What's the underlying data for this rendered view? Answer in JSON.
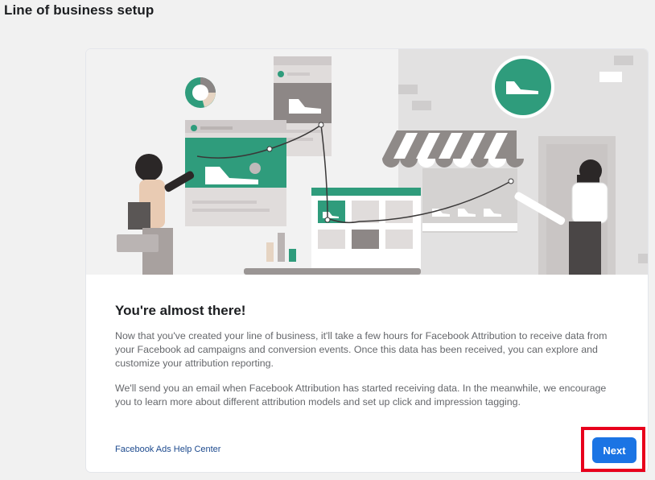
{
  "page": {
    "title": "Line of business setup"
  },
  "card": {
    "heading": "You're almost there!",
    "paragraph1": "Now that you've created your line of business, it'll take a few hours for Facebook Attribution to receive data from your Facebook ad campaigns and conversion events. Once this data has been received, you can explore and customize your attribution reporting.",
    "paragraph2": "We'll send you an email when Facebook Attribution has started receiving data. In the meanwhile, we encourage you to learn more about different attribution models and set up click and impression tagging.",
    "help_link": "Facebook Ads Help Center"
  },
  "actions": {
    "next_label": "Next"
  },
  "colors": {
    "accent": "#1b74e4",
    "highlight": "#e8001c",
    "illustration_green": "#2f9c7c"
  }
}
